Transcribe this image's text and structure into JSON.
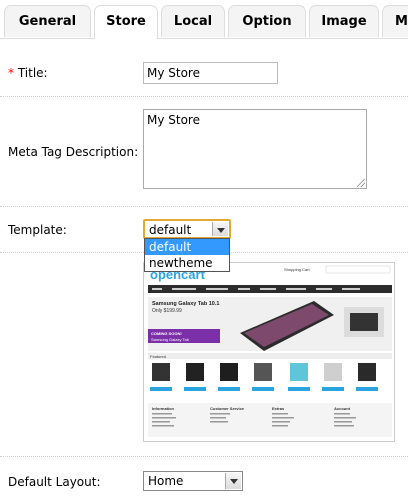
{
  "tabs": [
    {
      "label": "General"
    },
    {
      "label": "Store"
    },
    {
      "label": "Local"
    },
    {
      "label": "Option"
    },
    {
      "label": "Image"
    },
    {
      "label": "M"
    }
  ],
  "form": {
    "title": {
      "required_mark": "*",
      "label": "Title:",
      "value": "My Store"
    },
    "meta": {
      "label": "Meta Tag Description:",
      "value": "My Store"
    },
    "template": {
      "label": "Template:",
      "value": "default",
      "options": [
        "default",
        "newtheme"
      ]
    },
    "layout": {
      "label": "Default Layout:",
      "value": "Home"
    }
  },
  "preview": {
    "logo": "opencart",
    "cart_title": "Shopping Cart",
    "banner_title": "Samsung Galaxy Tab 10.1",
    "banner_price": "Only $199.99",
    "banner_badge_1": "COMING SOON!",
    "banner_badge_2": "Samsung Galaxy Tab",
    "featured": "Featured",
    "footer_cols": [
      "Information",
      "Customer Service",
      "Extras",
      "Account"
    ]
  },
  "colors": {
    "accent": "#e4a933",
    "selected": "#3399ff",
    "banner_purple": "#7b2fa8"
  }
}
